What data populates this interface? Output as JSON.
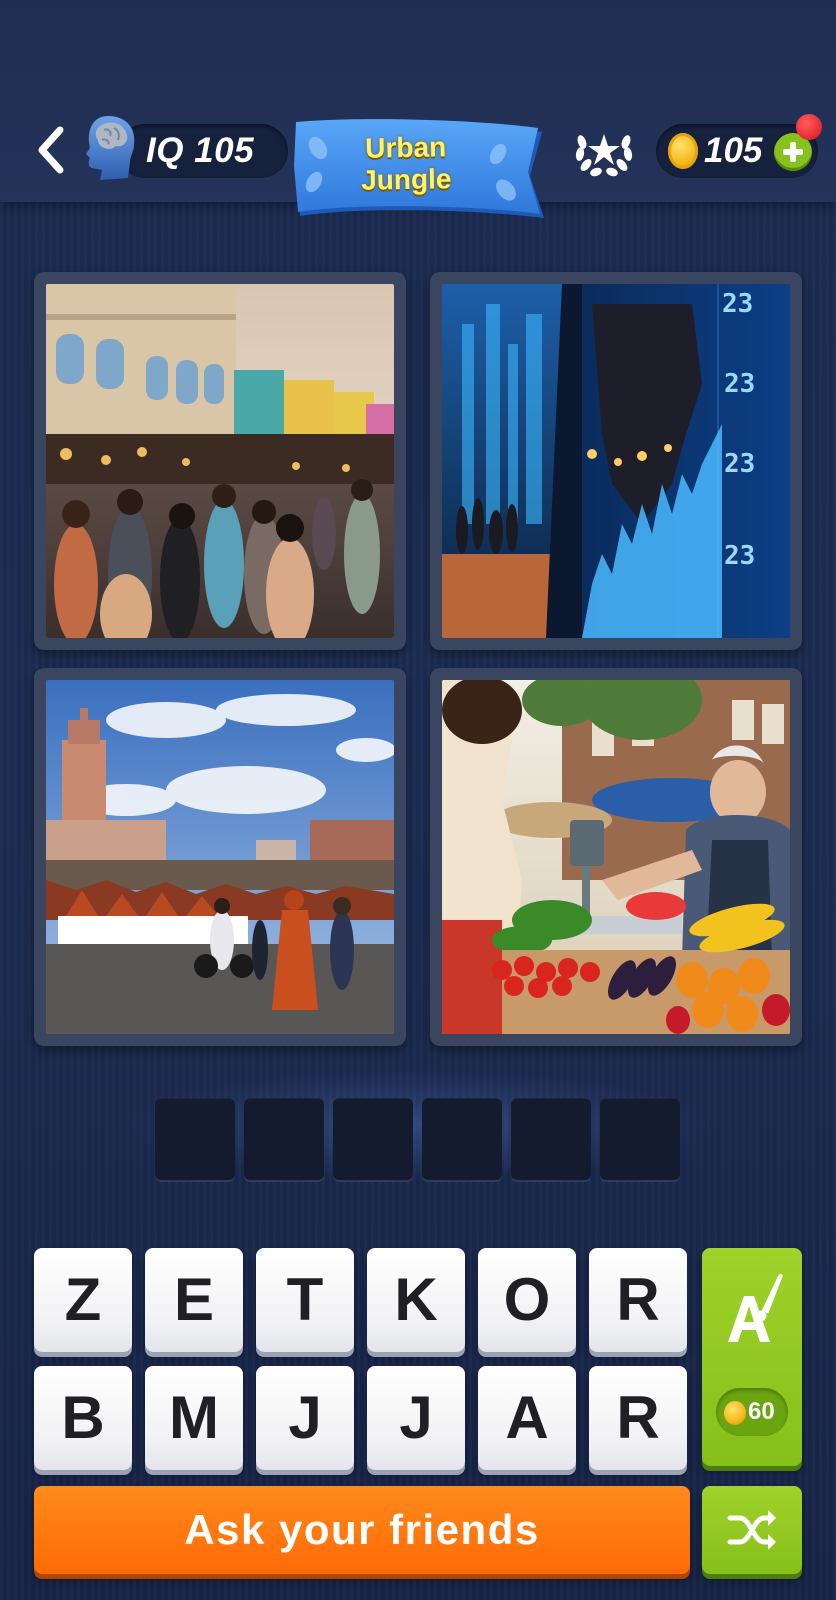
{
  "header": {
    "iq_text": "IQ 105",
    "level_title_line1": "Urban",
    "level_title_line2": "Jungle",
    "coins_text": "105"
  },
  "photos": [
    {
      "name": "street-market-crowd"
    },
    {
      "name": "stock-market-display"
    },
    {
      "name": "marrakech-market-square"
    },
    {
      "name": "vegetable-market-stall"
    }
  ],
  "answer": {
    "slots": [
      "",
      "",
      "",
      "",
      "",
      ""
    ]
  },
  "keyboard": {
    "row1": [
      "Z",
      "E",
      "T",
      "K",
      "O",
      "R"
    ],
    "row2": [
      "B",
      "M",
      "J",
      "J",
      "A",
      "R"
    ]
  },
  "hint": {
    "cost": "60"
  },
  "actions": {
    "ask_friends_label": "Ask your friends"
  },
  "colors": {
    "background": "#1b2a4f",
    "banner": "#3f8ff0",
    "banner_text": "#fff36a",
    "key_face": "#ffffff",
    "ask_button": "#ff7a10",
    "green_button": "#8fc81f",
    "notification": "#e01b24"
  },
  "icons": {
    "back": "chevron-left-icon",
    "iq": "brain-head-icon",
    "achievements": "laurel-star-icon",
    "coin": "coin-icon",
    "add_coins": "plus-icon",
    "hint": "paint-letter-icon",
    "shuffle": "shuffle-icon"
  }
}
